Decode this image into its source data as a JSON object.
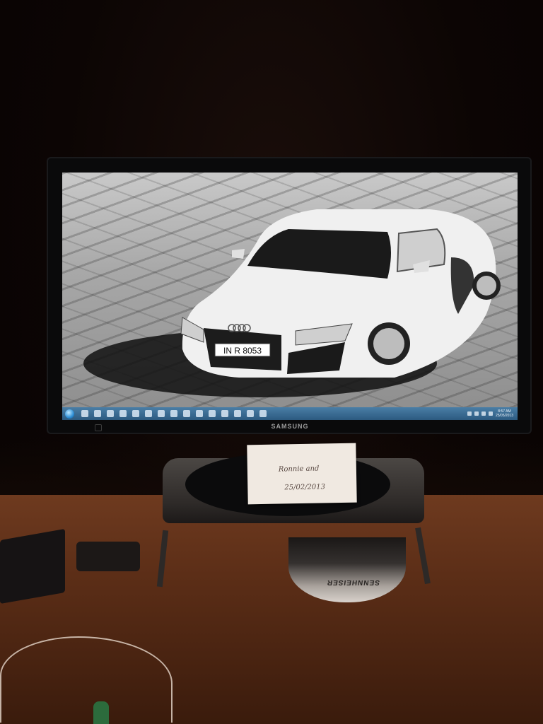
{
  "photo": {
    "monitor_brand": "SAMSUNG",
    "wallpaper_plate": "IN R 8053",
    "note_line1": "Ronnie and",
    "note_line2": "25/02/2013",
    "speaker_brand": "SENNHEISER",
    "clock_time": "8:57 AM",
    "clock_date": "25/05/2013"
  },
  "colors": {
    "taskbar": "#2c5a80",
    "desk": "#5c2e17",
    "car": "#f2f2f2"
  }
}
